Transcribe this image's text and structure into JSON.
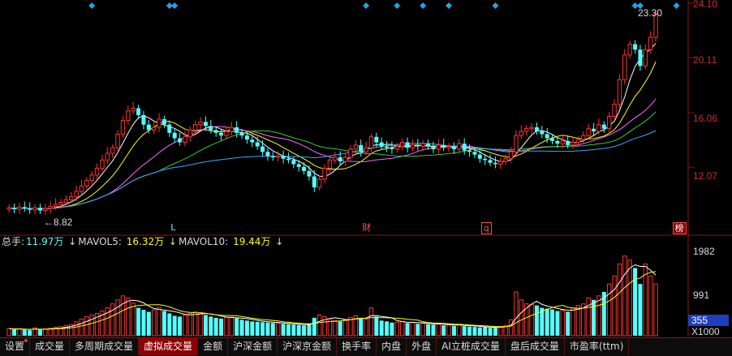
{
  "colors": {
    "up": "#ff3232",
    "down": "#54ffff",
    "grid": "#8a1414",
    "ma5": "#ffffff",
    "ma10": "#ffff00",
    "ma20": "#ff66ff",
    "ma30": "#33cc33",
    "ma60": "#33aaff",
    "volma5": "#ffffff",
    "volma10": "#ffff00",
    "signal": "#2aa0e0"
  },
  "price_axis": {
    "labels": [
      "24.10",
      "20.11",
      "16.06",
      "12.07"
    ],
    "max": 24.1,
    "min": 8.4
  },
  "price_tags": {
    "high": "23.30",
    "low": "8.82"
  },
  "markers": [
    {
      "text": "L",
      "color": "#54ffff",
      "boxed": false,
      "day": 32
    },
    {
      "text": "财",
      "color": "#ff5050",
      "boxed": false,
      "day": 69
    },
    {
      "text": "q",
      "color": "#ff5050",
      "boxed": true,
      "day": 92
    },
    {
      "text": "榜",
      "color": "#ffffff",
      "boxed": true,
      "bg": "#8b0000",
      "day": 129
    }
  ],
  "signal_days": [
    16,
    31,
    32,
    69,
    75,
    80,
    85,
    94,
    121,
    122,
    129
  ],
  "volume_info": {
    "total_label": "总手:",
    "total_value": "11.97万",
    "ma5_label": "MAVOL5:",
    "ma5_value": "16.32万",
    "ma10_label": "MAVOL10:",
    "ma10_value": "19.44万",
    "arrow": "↓"
  },
  "volume_axis": {
    "labels": [
      "1982",
      "991"
    ],
    "current": "355",
    "unit": "X1000",
    "max": 2300
  },
  "tabs": [
    {
      "label": "设置",
      "active": false,
      "dot": true
    },
    {
      "label": "成交量",
      "active": false
    },
    {
      "label": "多周期成交量",
      "active": false
    },
    {
      "label": "虚拟成交量",
      "active": true
    },
    {
      "label": "金额",
      "active": false
    },
    {
      "label": "沪深金额",
      "active": false
    },
    {
      "label": "沪深京金额",
      "active": false
    },
    {
      "label": "换手率",
      "active": false
    },
    {
      "label": "内盘",
      "active": false
    },
    {
      "label": "外盘",
      "active": false
    },
    {
      "label": "AI立桩成交量",
      "active": false
    },
    {
      "label": "盘后成交量",
      "active": false
    },
    {
      "label": "市盈率(ttm)",
      "active": false
    }
  ],
  "chart_data": {
    "type": "candlestick",
    "closes": [
      9.1,
      9.0,
      9.15,
      9.05,
      8.95,
      9.1,
      8.9,
      9.05,
      9.2,
      9.35,
      9.5,
      9.7,
      9.9,
      10.3,
      10.7,
      11.1,
      11.5,
      12.0,
      12.6,
      13.1,
      13.5,
      14.5,
      15.5,
      16.2,
      16.4,
      15.9,
      15.2,
      14.8,
      15.0,
      15.6,
      15.2,
      14.6,
      14.2,
      13.9,
      14.3,
      14.8,
      15.2,
      15.4,
      15.1,
      14.8,
      14.6,
      14.4,
      14.7,
      15.0,
      14.6,
      14.4,
      14.1,
      13.9,
      13.6,
      13.2,
      12.9,
      12.8,
      12.9,
      12.7,
      12.6,
      12.3,
      12.1,
      11.8,
      11.4,
      10.6,
      11.2,
      12.0,
      12.6,
      12.8,
      12.5,
      12.8,
      13.4,
      13.7,
      13.2,
      13.5,
      14.3,
      13.9,
      13.6,
      13.5,
      13.4,
      13.6,
      13.9,
      13.5,
      13.7,
      13.6,
      13.8,
      13.6,
      13.4,
      13.7,
      13.5,
      13.6,
      13.4,
      13.8,
      13.3,
      13.2,
      13.0,
      12.7,
      12.6,
      12.4,
      12.3,
      12.5,
      12.7,
      13.2,
      14.4,
      14.7,
      14.9,
      15.0,
      14.7,
      14.5,
      14.2,
      14.0,
      13.8,
      14.0,
      13.7,
      13.9,
      14.1,
      14.4,
      14.9,
      14.7,
      15.2,
      14.9,
      15.8,
      16.7,
      18.5,
      20.3,
      21.1,
      20.7,
      19.5,
      20.7,
      21.6,
      23.3
    ],
    "volumes": [
      180,
      160,
      170,
      150,
      140,
      200,
      150,
      170,
      190,
      210,
      230,
      260,
      280,
      350,
      420,
      480,
      520,
      560,
      620,
      700,
      800,
      900,
      1000,
      950,
      820,
      700,
      650,
      600,
      650,
      700,
      620,
      560,
      500,
      480,
      520,
      560,
      600,
      580,
      520,
      480,
      450,
      430,
      460,
      470,
      440,
      400,
      380,
      360,
      350,
      340,
      330,
      320,
      310,
      300,
      290,
      280,
      270,
      260,
      300,
      450,
      520,
      480,
      420,
      380,
      360,
      400,
      460,
      500,
      430,
      420,
      700,
      480,
      380,
      360,
      330,
      340,
      360,
      320,
      330,
      300,
      310,
      290,
      280,
      300,
      260,
      270,
      250,
      280,
      240,
      230,
      220,
      210,
      220,
      200,
      210,
      230,
      260,
      400,
      1100,
      900,
      800,
      780,
      760,
      700,
      680,
      660,
      620,
      640,
      600,
      700,
      760,
      800,
      950,
      900,
      1000,
      1100,
      1300,
      1500,
      1800,
      2000,
      1900,
      1700,
      1300,
      1800,
      1500,
      1300
    ]
  }
}
